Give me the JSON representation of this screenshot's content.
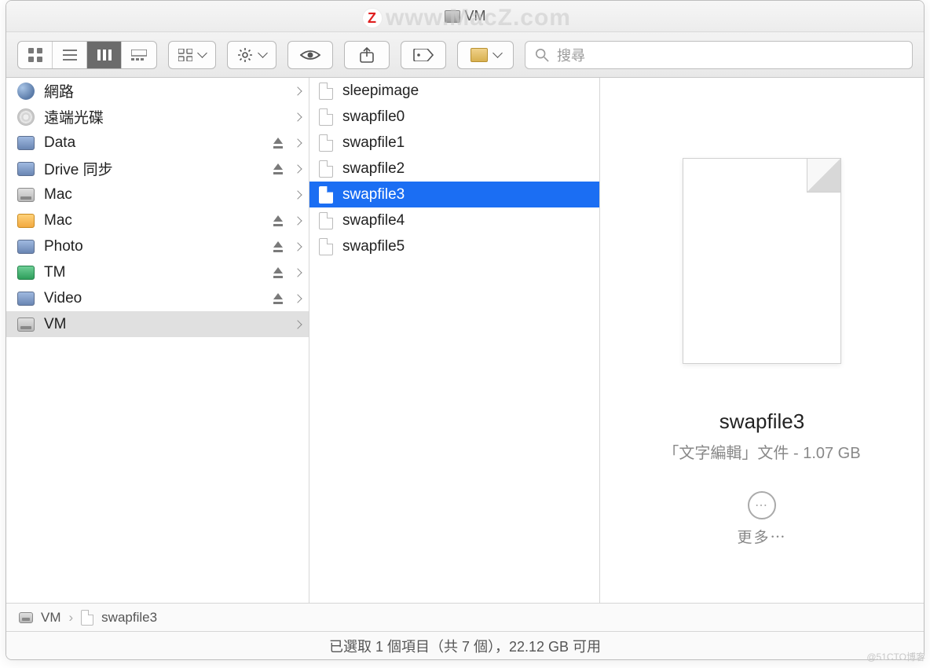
{
  "window": {
    "title": "VM"
  },
  "watermark": "www.MacZ.com",
  "toolbar": {
    "search_placeholder": "搜尋"
  },
  "sidebar": {
    "items": [
      {
        "label": "網路",
        "icon": "globe",
        "eject": false,
        "selected": false
      },
      {
        "label": "遠端光碟",
        "icon": "disc",
        "eject": false,
        "selected": false
      },
      {
        "label": "Data",
        "icon": "net",
        "eject": true,
        "selected": false
      },
      {
        "label": "Drive 同步",
        "icon": "net",
        "eject": true,
        "selected": false
      },
      {
        "label": "Mac",
        "icon": "hdd",
        "eject": false,
        "selected": false
      },
      {
        "label": "Mac",
        "icon": "orange",
        "eject": true,
        "selected": false
      },
      {
        "label": "Photo",
        "icon": "net",
        "eject": true,
        "selected": false
      },
      {
        "label": "TM",
        "icon": "green",
        "eject": true,
        "selected": false
      },
      {
        "label": "Video",
        "icon": "net",
        "eject": true,
        "selected": false
      },
      {
        "label": "VM",
        "icon": "hdd",
        "eject": false,
        "selected": true
      }
    ]
  },
  "files": [
    {
      "name": "sleepimage",
      "selected": false
    },
    {
      "name": "swapfile0",
      "selected": false
    },
    {
      "name": "swapfile1",
      "selected": false
    },
    {
      "name": "swapfile2",
      "selected": false
    },
    {
      "name": "swapfile3",
      "selected": true
    },
    {
      "name": "swapfile4",
      "selected": false
    },
    {
      "name": "swapfile5",
      "selected": false
    }
  ],
  "preview": {
    "name": "swapfile3",
    "meta": "「文字編輯」文件 - 1.07 GB",
    "more": "更多⋯"
  },
  "path": {
    "folder": "VM",
    "file": "swapfile3"
  },
  "status": "已選取 1 個項目（共 7 個），22.12 GB 可用",
  "credit": "@51CTO博客"
}
